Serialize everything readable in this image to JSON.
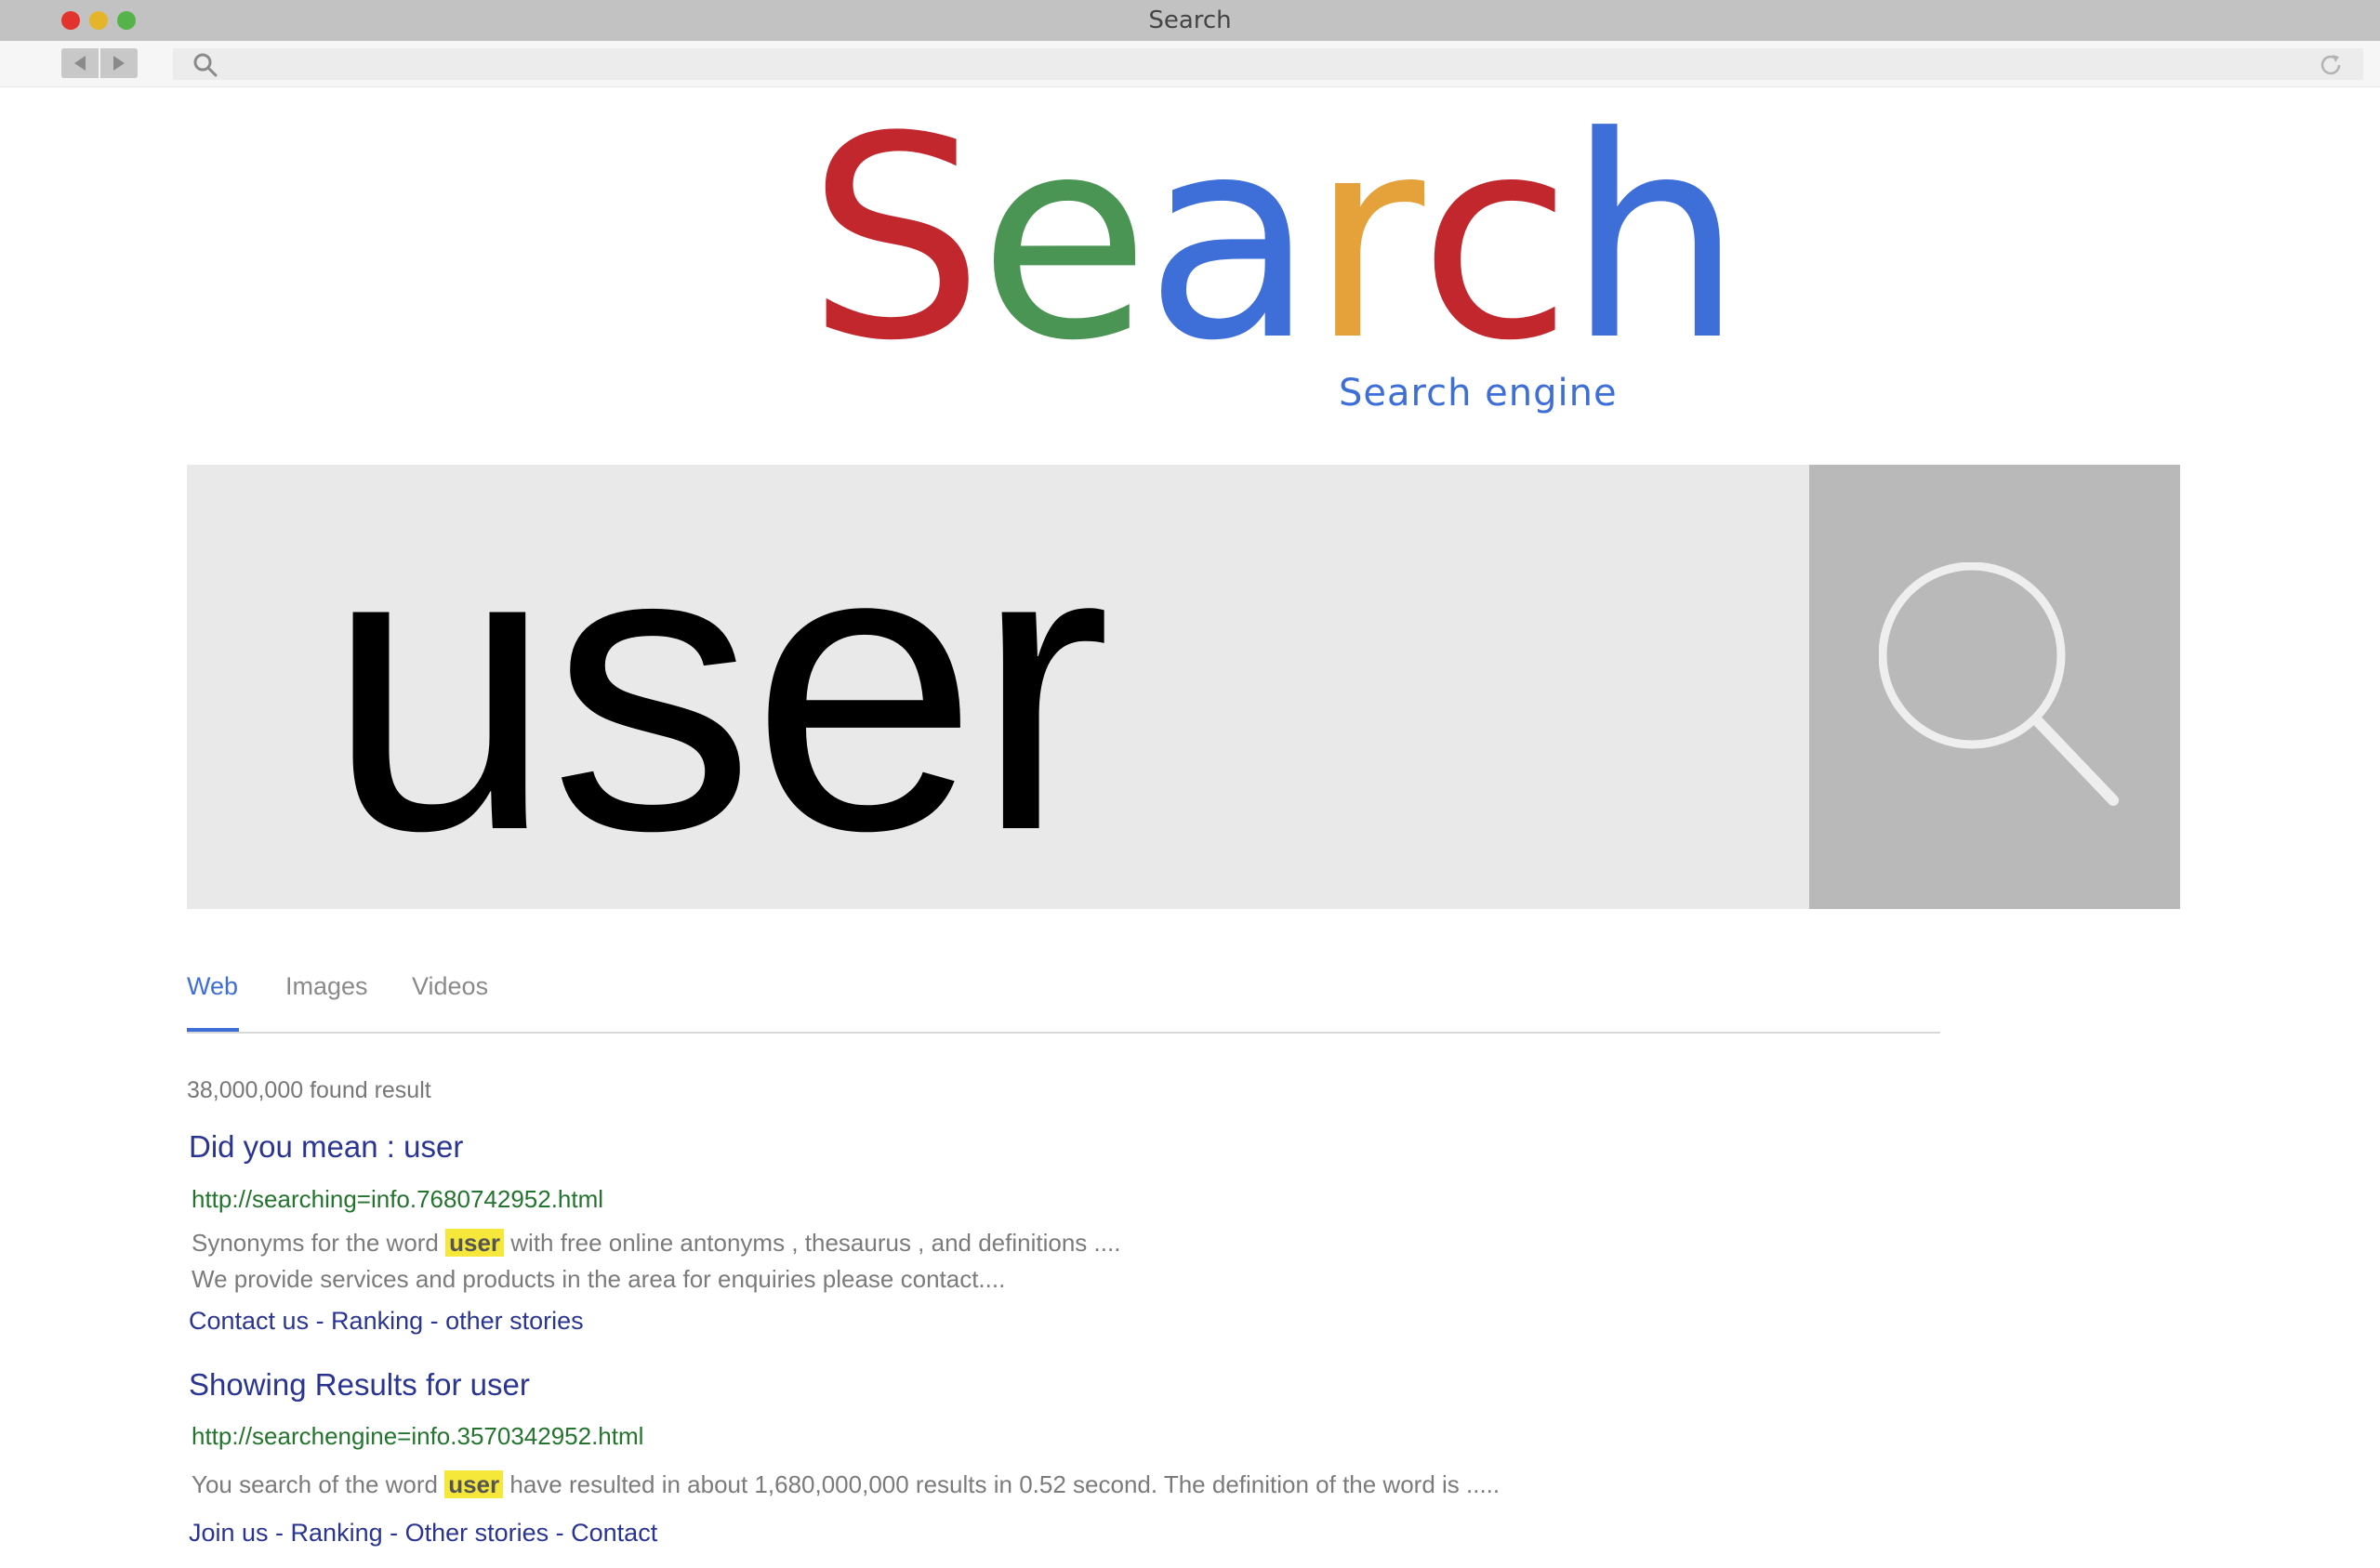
{
  "window": {
    "title": "Search"
  },
  "toolbar": {
    "back_icon": "triangle-left-icon",
    "forward_icon": "triangle-right-icon",
    "search_icon": "magnifier-icon",
    "reload_icon": "reload-icon"
  },
  "logo": {
    "letters": [
      {
        "char": "S",
        "color": "#c1272d"
      },
      {
        "char": "e",
        "color": "#4a9454"
      },
      {
        "char": "a",
        "color": "#3e6fd8"
      },
      {
        "char": "r",
        "color": "#e6a23a"
      },
      {
        "char": "c",
        "color": "#c1272d"
      },
      {
        "char": "h",
        "color": "#3e6fd8"
      }
    ],
    "subtitle": "Search engine"
  },
  "search": {
    "query": "user",
    "button_icon": "magnifier-icon"
  },
  "tabs": [
    {
      "label": "Web",
      "active": true
    },
    {
      "label": "Images",
      "active": false
    },
    {
      "label": "Videos",
      "active": false
    }
  ],
  "results": {
    "count_text": "38,000,000 found result",
    "items": [
      {
        "title": "Did you mean : user",
        "url": "http://searching=info.7680742952.html",
        "desc1_before": "Synonyms for the word ",
        "desc1_highlight": "user",
        "desc1_after": " with free online antonyms , thesaurus , and definitions ....",
        "desc2": "We provide services and products in the area for enquiries please contact....",
        "links": "Contact us - Ranking - other stories"
      },
      {
        "title": "Showing Results for user",
        "url": "http://searchengine=info.3570342952.html",
        "desc1_before": "You search of the word ",
        "desc1_highlight": "user",
        "desc1_after": " have resulted in about 1,680,000,000 results in 0.52 second. The definition of the word is .....",
        "links": "Join us - Ranking - Other stories - Contact"
      }
    ]
  },
  "colors": {
    "accent": "#3e6fd8",
    "result_title": "#2a3593",
    "result_url": "#23742d",
    "highlight": "#f6e83a"
  }
}
